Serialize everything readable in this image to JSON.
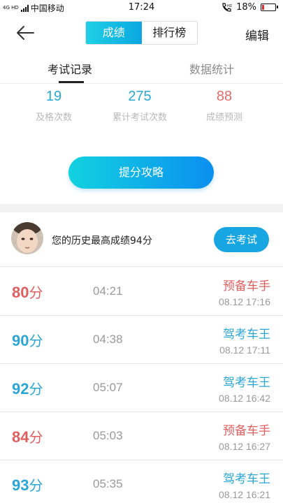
{
  "status_bar": {
    "network_label": "4G HD",
    "carrier": "中国移动",
    "time": "17:24",
    "battery_percent_text": "18%",
    "battery_level": 0.18,
    "icons": [
      "signal-icon",
      "call-hd-icon",
      "battery-icon"
    ]
  },
  "nav": {
    "back_icon": "arrow-left-icon",
    "tabs": [
      "成绩",
      "排行榜"
    ],
    "active_tab": "成绩",
    "edit_label": "编辑"
  },
  "subtabs": {
    "items": [
      "考试记录",
      "数据统计"
    ],
    "active": "考试记录"
  },
  "stats": [
    {
      "value": "19",
      "label": "及格次数",
      "color": "#29a8d6"
    },
    {
      "value": "275",
      "label": "累计考试次数",
      "color": "#29a8d6"
    },
    {
      "value": "88",
      "label": "成绩预测",
      "color": "#e46b6b"
    }
  ],
  "strategy_button": "提分攻略",
  "best_score": {
    "text": "您的历史最高成绩94分",
    "button": "去考试"
  },
  "records": [
    {
      "score": "80",
      "unit": "分",
      "duration": "04:21",
      "level": "预备车手",
      "date": "08.12  17:16",
      "color": "#e05e5e"
    },
    {
      "score": "90",
      "unit": "分",
      "duration": "04:38",
      "level": "驾考车王",
      "date": "08.12  17:11",
      "color": "#2aa6d6"
    },
    {
      "score": "92",
      "unit": "分",
      "duration": "05:07",
      "level": "驾考车王",
      "date": "08.12  16:42",
      "color": "#2aa6d6"
    },
    {
      "score": "84",
      "unit": "分",
      "duration": "05:03",
      "level": "预备车手",
      "date": "08.12  16:27",
      "color": "#e05e5e"
    },
    {
      "score": "93",
      "unit": "分",
      "duration": "05:35",
      "level": "驾考车王",
      "date": "08.12  16:21",
      "color": "#2aa6d6"
    }
  ]
}
